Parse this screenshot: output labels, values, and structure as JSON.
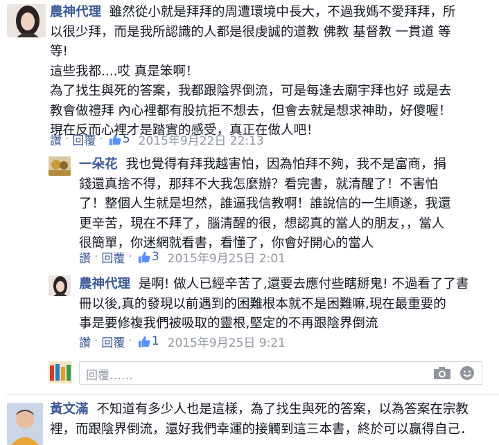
{
  "comments": [
    {
      "author": "農神代理",
      "lines": [
        "雖然從小就是拜拜的周遭環境中長大，不過我媽不愛拜拜，所",
        "以很少拜，而是我所認識的人都是很虔誠的道教 佛教 基督教 一貫道 等",
        "等!",
        "這些我都....哎 真是笨啊！",
        "為了找生與死的答案，我都跟陰界倒流，可是每逢去廟宇拜也好 或是去",
        "教會做禮拜 內心裡都有股抗拒不想去，但會去就是想求神助，好傻喔！",
        "現在反而心裡才是踏實的感受，真正在做人吧！"
      ],
      "read": "讚",
      "reply": "回覆",
      "likes": "5",
      "time": "2015年9月22日 22:13"
    },
    {
      "author": "一朵花",
      "lines": [
        "我也覺得有拜我越害怕，因為怕拜不夠，我不是富商，捐",
        "錢還真捨不得，那拜不大我怎麼辦？看完書，就清醒了！不害怕",
        "了！整個人生就是坦然，誰逼我信教啊！誰說信的一生順遂，我還",
        "更辛苦，現在不拜了，腦清醒的很，想認真的當人的朋友，，當人",
        "很簡單，你迷網就看書，看懂了，你會好開心的當人"
      ],
      "read": "讚",
      "reply": "回覆",
      "likes": "3",
      "time": "2015年9月25日 2:01"
    },
    {
      "author": "農神代理",
      "lines": [
        "是啊! 做人已經辛苦了,還要去應付些瞎掰鬼! 不過看了了書",
        "冊以後,真的發現以前遇到的困難根本就不是困難嘛,現在最重要的",
        "事是要修複我們被吸取的靈根,堅定的不再跟陰界倒流"
      ],
      "read": "讚",
      "reply": "回覆",
      "likes": "1",
      "time": "2015年9月25日 9:21"
    },
    {
      "author": "黃文滿",
      "lines": [
        "不知道有多少人也是這樣，為了找生與死的答案，以為答案在宗教",
        "裡，而跟陰界倒流，還好我們幸運的接觸到這三本書，終於可以贏得自己．"
      ]
    }
  ],
  "reply_box": {
    "placeholder": "回覆……"
  }
}
